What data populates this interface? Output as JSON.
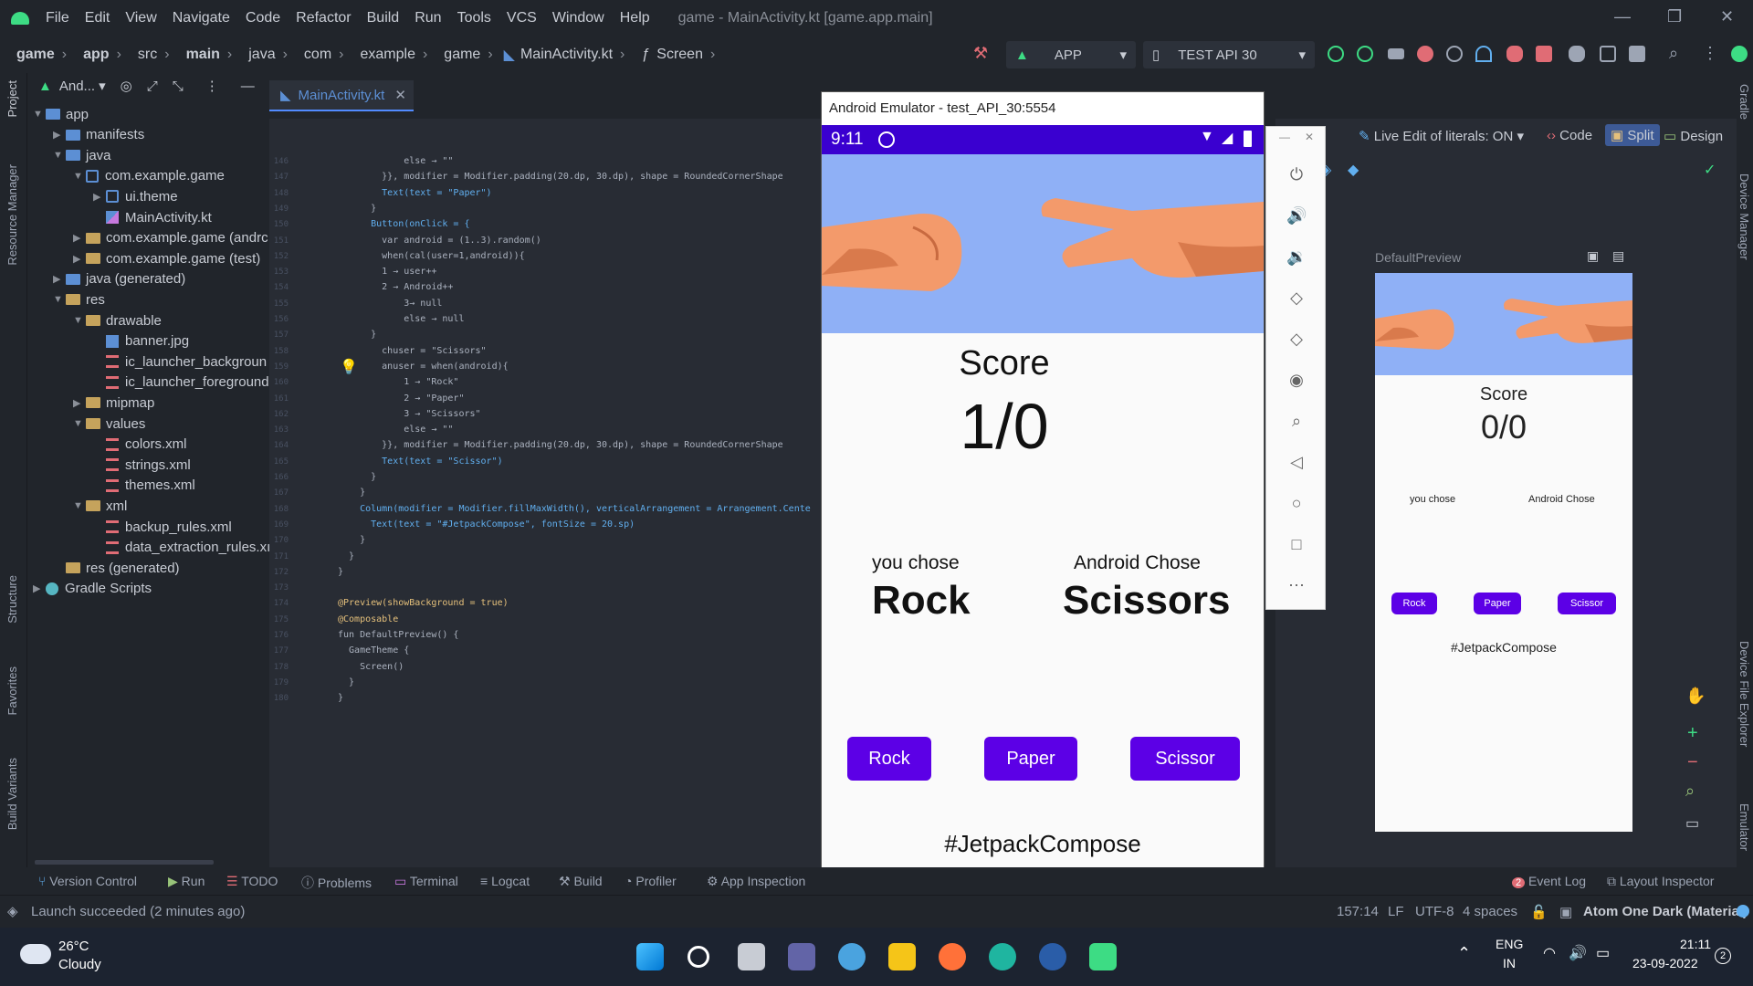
{
  "menu": {
    "items": [
      "File",
      "Edit",
      "View",
      "Navigate",
      "Code",
      "Refactor",
      "Build",
      "Run",
      "Tools",
      "VCS",
      "Window",
      "Help"
    ],
    "window_title": "game - MainActivity.kt [game.app.main]"
  },
  "breadcrumb": [
    "game",
    "app",
    "src",
    "main",
    "java",
    "com",
    "example",
    "game",
    "MainActivity.kt",
    "Screen"
  ],
  "toolbar": {
    "run_config": "APP",
    "device": "TEST API 30"
  },
  "project_panel": {
    "title": "And..."
  },
  "tree": [
    {
      "label": "app",
      "indent": 0,
      "type": "folder-blue",
      "arrow": "down"
    },
    {
      "label": "manifests",
      "indent": 1,
      "type": "folder-blue",
      "arrow": "right"
    },
    {
      "label": "java",
      "indent": 1,
      "type": "folder-blue",
      "arrow": "down"
    },
    {
      "label": "com.example.game",
      "indent": 2,
      "type": "package",
      "arrow": "down"
    },
    {
      "label": "ui.theme",
      "indent": 3,
      "type": "package",
      "arrow": "right"
    },
    {
      "label": "MainActivity.kt",
      "indent": 3,
      "type": "kotlin",
      "arrow": ""
    },
    {
      "label": "com.example.game (andrc",
      "indent": 2,
      "type": "folder",
      "arrow": "right"
    },
    {
      "label": "com.example.game (test)",
      "indent": 2,
      "type": "folder",
      "arrow": "right"
    },
    {
      "label": "java (generated)",
      "indent": 1,
      "type": "folder-blue",
      "arrow": "right"
    },
    {
      "label": "res",
      "indent": 1,
      "type": "folder",
      "arrow": "down"
    },
    {
      "label": "drawable",
      "indent": 2,
      "type": "folder",
      "arrow": "down"
    },
    {
      "label": "banner.jpg",
      "indent": 3,
      "type": "image",
      "arrow": ""
    },
    {
      "label": "ic_launcher_backgroun",
      "indent": 3,
      "type": "xml",
      "arrow": ""
    },
    {
      "label": "ic_launcher_foreground",
      "indent": 3,
      "type": "xml",
      "arrow": ""
    },
    {
      "label": "mipmap",
      "indent": 2,
      "type": "folder",
      "arrow": "right"
    },
    {
      "label": "values",
      "indent": 2,
      "type": "folder",
      "arrow": "down"
    },
    {
      "label": "colors.xml",
      "indent": 3,
      "type": "xml",
      "arrow": ""
    },
    {
      "label": "strings.xml",
      "indent": 3,
      "type": "xml",
      "arrow": ""
    },
    {
      "label": "themes.xml",
      "indent": 3,
      "type": "xml",
      "arrow": ""
    },
    {
      "label": "xml",
      "indent": 2,
      "type": "folder",
      "arrow": "down"
    },
    {
      "label": "backup_rules.xml",
      "indent": 3,
      "type": "xml",
      "arrow": ""
    },
    {
      "label": "data_extraction_rules.xı",
      "indent": 3,
      "type": "xml",
      "arrow": ""
    },
    {
      "label": "res (generated)",
      "indent": 1,
      "type": "folder",
      "arrow": ""
    },
    {
      "label": "Gradle Scripts",
      "indent": 0,
      "type": "gradle",
      "arrow": "right"
    }
  ],
  "left_tools": [
    "Project",
    "Resource Manager",
    "Structure",
    "Favorites",
    "Build Variants"
  ],
  "right_tools": [
    "Gradle",
    "Device Manager",
    "Device File Explorer",
    "Emulator"
  ],
  "editor": {
    "tab": "MainActivity.kt",
    "lines": [
      {
        "n": "146",
        "code": "            else → \"\""
      },
      {
        "n": "147",
        "code": "        }}, modifier = Modifier.padding(20.dp, 30.dp), shape = RoundedCornerShape"
      },
      {
        "n": "148",
        "code": "        Text(text = \"Paper\")"
      },
      {
        "n": "149",
        "code": "      }"
      },
      {
        "n": "150",
        "code": "      Button(onClick = {"
      },
      {
        "n": "151",
        "code": "        var android = (1..3).random()"
      },
      {
        "n": "152",
        "code": "        when(cal(user=1,android)){"
      },
      {
        "n": "153",
        "code": "        1 → user++"
      },
      {
        "n": "154",
        "code": "        2 → Android++"
      },
      {
        "n": "155",
        "code": "            3→ null"
      },
      {
        "n": "156",
        "code": "            else → null"
      },
      {
        "n": "157",
        "code": "      }"
      },
      {
        "n": "158",
        "code": "        chuser = \"Scissors\""
      },
      {
        "n": "159",
        "code": "        anuser = when(android){"
      },
      {
        "n": "160",
        "code": "            1 → \"Rock\""
      },
      {
        "n": "161",
        "code": "            2 → \"Paper\""
      },
      {
        "n": "162",
        "code": "            3 → \"Scissors\""
      },
      {
        "n": "163",
        "code": "            else → \"\""
      },
      {
        "n": "164",
        "code": "        }}, modifier = Modifier.padding(20.dp, 30.dp), shape = RoundedCornerShape"
      },
      {
        "n": "165",
        "code": "        Text(text = \"Scissor\")"
      },
      {
        "n": "166",
        "code": "      }"
      },
      {
        "n": "167",
        "code": "    }"
      },
      {
        "n": "168",
        "code": "    Column(modifier = Modifier.fillMaxWidth(), verticalArrangement = Arrangement.Cente"
      },
      {
        "n": "169",
        "code": "      Text(text = \"#JetpackCompose\", fontSize = 20.sp)"
      },
      {
        "n": "170",
        "code": "    }"
      },
      {
        "n": "171",
        "code": "  }"
      },
      {
        "n": "172",
        "code": "}"
      },
      {
        "n": "173",
        "code": ""
      },
      {
        "n": "174",
        "code": "@Preview(showBackground = true)"
      },
      {
        "n": "175",
        "code": "@Composable"
      },
      {
        "n": "176",
        "code": "fun DefaultPreview() {"
      },
      {
        "n": "177",
        "code": "  GameTheme {"
      },
      {
        "n": "178",
        "code": "    Screen()"
      },
      {
        "n": "179",
        "code": "  }"
      },
      {
        "n": "180",
        "code": "}"
      }
    ]
  },
  "emulator": {
    "title": "Android Emulator - test_API_30:5554",
    "time": "9:11",
    "score_label": "Score",
    "score": "1/0",
    "you_chose_label": "you chose",
    "you_chose": "Rock",
    "android_chose_label": "Android Chose",
    "android_chose": "Scissors",
    "buttons": [
      "Rock",
      "Paper",
      "Scissor"
    ],
    "hashtag": "#JetpackCompose"
  },
  "design_toolbar": {
    "live_edit": "Live Edit of literals: ON",
    "code": "Code",
    "split": "Split",
    "design": "Design"
  },
  "preview": {
    "label": "DefaultPreview",
    "score_label": "Score",
    "score": "0/0",
    "you_chose_label": "you chose",
    "android_chose_label": "Android Chose",
    "buttons": [
      "Rock",
      "Paper",
      "Scissor"
    ],
    "hashtag": "#JetpackCompose"
  },
  "bottom_tools": [
    "Version Control",
    "Run",
    "TODO",
    "Problems",
    "Terminal",
    "Logcat",
    "Build",
    "Profiler",
    "App Inspection"
  ],
  "bottom_right_tools": [
    "Event Log",
    "Layout Inspector"
  ],
  "event_log_count": "2",
  "status": {
    "message": "Launch succeeded (2 minutes ago)",
    "position": "157:14",
    "line_ending": "LF",
    "encoding": "UTF-8",
    "indent": "4 spaces",
    "theme": "Atom One Dark (Material)"
  },
  "taskbar": {
    "temp": "26°C",
    "weather": "Cloudy",
    "lang1": "ENG",
    "lang2": "IN",
    "time": "21:11",
    "date": "23-09-2022",
    "notif": "2"
  },
  "colors": {
    "accent": "#5c00e6",
    "status_bar": "#3a00d0",
    "banner_bg": "#8fb0f6",
    "ide_bg": "#282c34"
  }
}
